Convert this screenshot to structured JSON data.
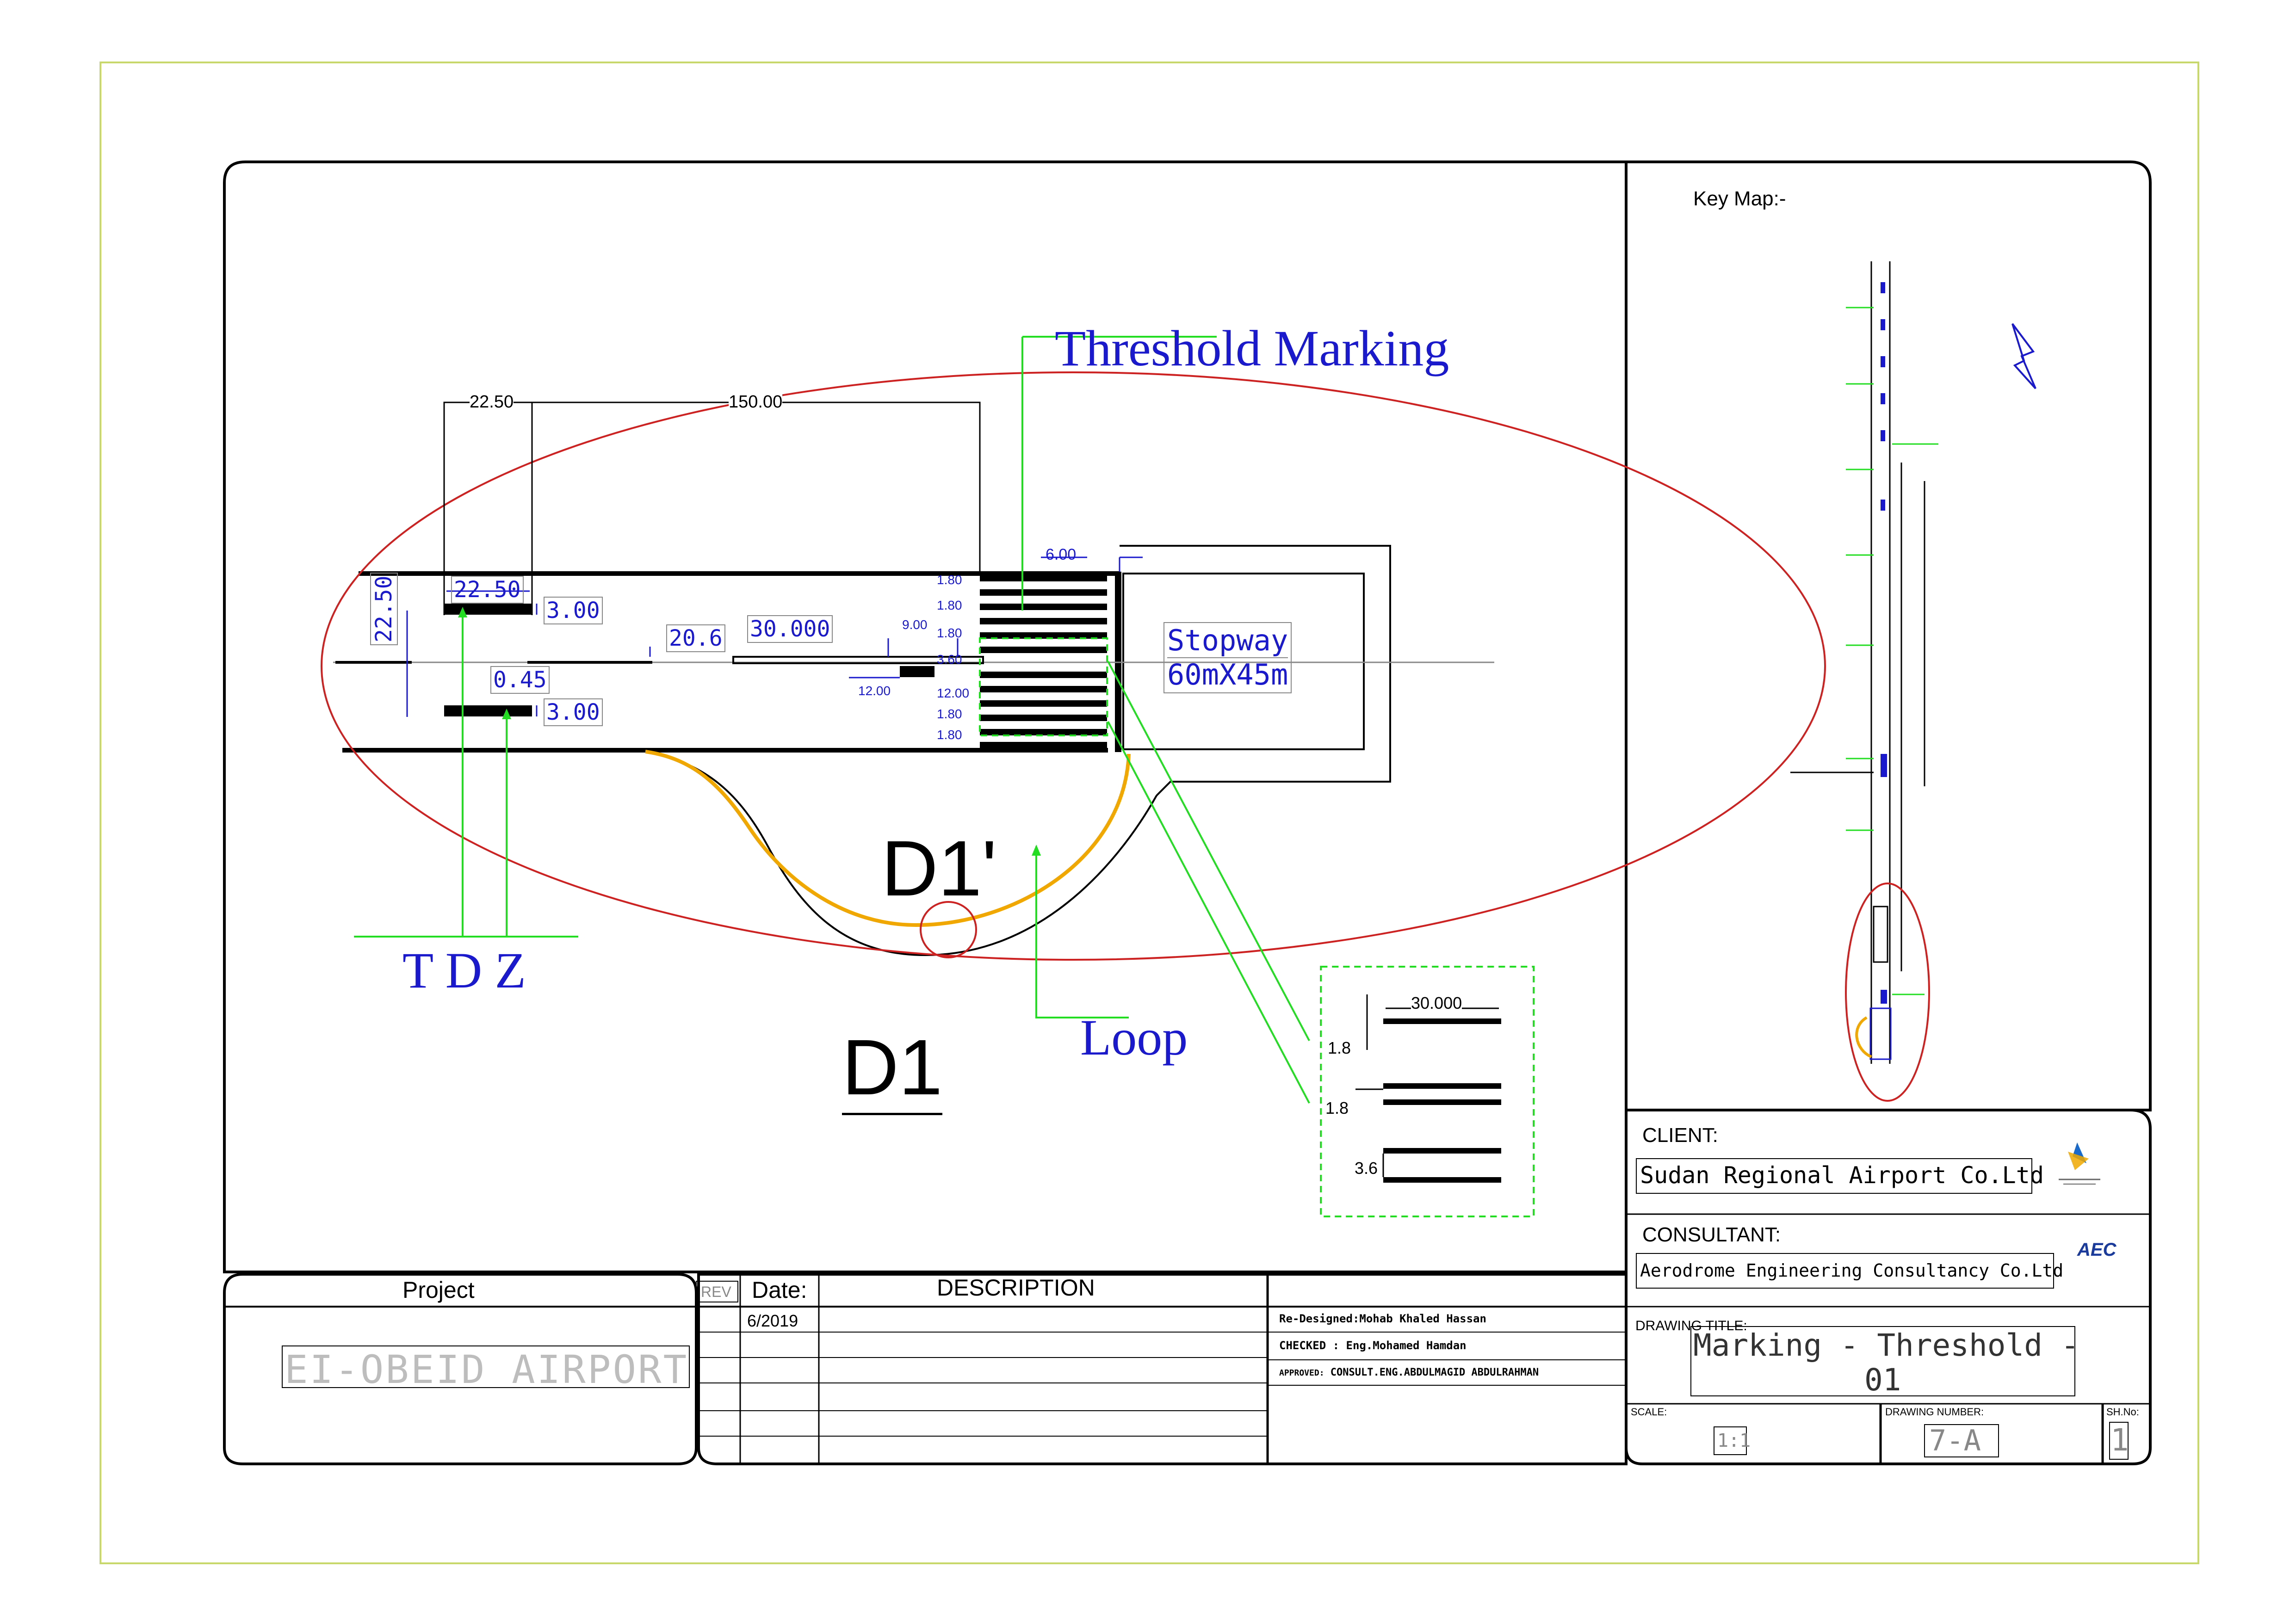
{
  "labels": {
    "threshold_marking": "Threshold Marking",
    "tdz": "T D Z",
    "loop": "Loop",
    "d1": "D1",
    "d1_prime": "D1'",
    "stopway_1": "Stopway",
    "stopway_2": "60mX45m",
    "key_map": "Key Map:-"
  },
  "dimensions": {
    "d_22_50_top": "22.50",
    "d_150": "150.00",
    "d_22_50_box": "22.50",
    "d_3_00_a": "3.00",
    "d_22_50_vert": "22.50",
    "d_0_45": "0.45",
    "d_3_00_b": "3.00",
    "d_20_6": "20.6",
    "d_30_000": "30.000",
    "d_9_00": "9.00",
    "d_12_00_a": "12.00",
    "d_6_00": "6.00",
    "stripe_1": "1.80",
    "stripe_2": "1.80",
    "stripe_3": "1.80",
    "stripe_4": "3.60",
    "stripe_5": "12.00",
    "stripe_6": "1.80",
    "stripe_7": "1.80"
  },
  "detail": {
    "d_30_000": "30.000",
    "d_1_8_a": "1.8",
    "d_1_8_b": "1.8",
    "d_3_6": "3.6"
  },
  "title_block": {
    "project_label": "Project",
    "project_name": "EI-OBEID AIRPORT",
    "rev_label": "REV",
    "date_label": "Date:",
    "description_label": "DESCRIPTION",
    "date_value": "6/2019",
    "redesigned_label": "Re-Designed:",
    "redesigned_value": "Mohab Khaled Hassan",
    "checked_label": "CHECKED",
    "checked_value": ": Eng.Mohamed Hamdan",
    "approved_label": "APPROVED:",
    "approved_value": "CONSULT.ENG.ABDULMAGID ABDULRAHMAN",
    "client_label": "CLIENT:",
    "client_name": "Sudan Regional Airport Co.Ltd",
    "consultant_label": "CONSULTANT:",
    "consultant_name": "Aerodrome Engineering Consultancy Co.Ltd",
    "consultant_logo": "AEC",
    "drawing_title_label": "DRAWING TITLE:",
    "drawing_title_1": "Marking - Threshold -",
    "drawing_title_2": "01",
    "scale_label": "SCALE:",
    "scale_value": "1:1",
    "drawing_number_label": "DRAWING NUMBER:",
    "drawing_number_value": "7-A",
    "sheet_no_label": "SH.No:",
    "sheet_no_value": "1"
  },
  "colors": {
    "dim_blue": "#1a1acc",
    "leader_green": "#22dd22",
    "ellipse_red": "#cc2222",
    "loop_orange": "#f0a800",
    "frame_green": "#c8d86a"
  }
}
